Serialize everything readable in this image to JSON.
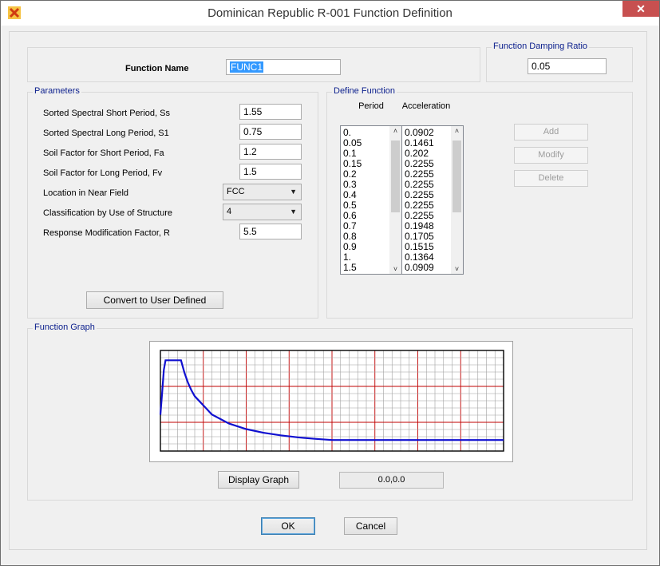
{
  "window": {
    "title": "Dominican Republic R-001 Function Definition",
    "close_glyph": "✕",
    "icon": "sap-x-icon"
  },
  "function_name": {
    "label": "Function Name",
    "value": "FUNC1"
  },
  "damping": {
    "title": "Function Damping Ratio",
    "value": "0.05"
  },
  "parameters": {
    "title": "Parameters",
    "fields": [
      {
        "label": "Sorted Spectral Short Period, Ss",
        "value": "1.55"
      },
      {
        "label": "Sorted Spectral Long Period, S1",
        "value": "0.75"
      },
      {
        "label": "Soil Factor for Short Period, Fa",
        "value": "1.2"
      },
      {
        "label": "Soil Factor for Long Period, Fv",
        "value": "1.5"
      }
    ],
    "location": {
      "label": "Location in Near Field",
      "value": "FCC"
    },
    "classification": {
      "label": "Classification by Use of Structure",
      "value": "4"
    },
    "response": {
      "label": "Response Modification Factor, R",
      "value": "5.5"
    },
    "convert_button": "Convert to User Defined"
  },
  "define_function": {
    "title": "Define Function",
    "period_header": "Period",
    "accel_header": "Acceleration",
    "periods": [
      "0.",
      "0.05",
      "0.1",
      "0.15",
      "0.2",
      "0.3",
      "0.4",
      "0.5",
      "0.6",
      "0.7",
      "0.8",
      "0.9",
      "1.",
      "1.5"
    ],
    "accelerations": [
      "0.0902",
      "0.1461",
      "0.202",
      "0.2255",
      "0.2255",
      "0.2255",
      "0.2255",
      "0.2255",
      "0.2255",
      "0.1948",
      "0.1705",
      "0.1515",
      "0.1364",
      "0.0909"
    ],
    "add_button": "Add",
    "modify_button": "Modify",
    "delete_button": "Delete"
  },
  "graph": {
    "title": "Function Graph",
    "display_button": "Display Graph",
    "coords": "0.0,0.0"
  },
  "footer": {
    "ok": "OK",
    "cancel": "Cancel"
  },
  "colors": {
    "group_title": "#0a1e8c",
    "curve": "#1010d0",
    "major_grid": "#c00000",
    "minor_grid": "#a0a0a0",
    "close_bg": "#c75050"
  },
  "chart_data": {
    "type": "line",
    "grid": true,
    "series": [
      {
        "x": [
          0,
          0.05,
          0.1,
          0.15,
          0.2,
          0.3,
          0.4,
          0.5,
          0.6,
          0.7,
          0.8,
          0.9,
          1.0,
          1.5,
          2.0,
          2.5,
          3.0,
          3.5,
          4.0,
          4.5,
          5.0,
          6.0,
          7.0,
          8.0,
          10.0
        ],
        "y": [
          0.0902,
          0.1461,
          0.202,
          0.2255,
          0.2255,
          0.2255,
          0.2255,
          0.2255,
          0.2255,
          0.1948,
          0.1705,
          0.1515,
          0.1364,
          0.0909,
          0.0682,
          0.0546,
          0.0455,
          0.039,
          0.0341,
          0.0303,
          0.0273,
          0.0273,
          0.0273,
          0.0273,
          0.0273
        ]
      }
    ],
    "xlim": [
      0,
      10
    ],
    "ylim": [
      0,
      0.25
    ]
  }
}
